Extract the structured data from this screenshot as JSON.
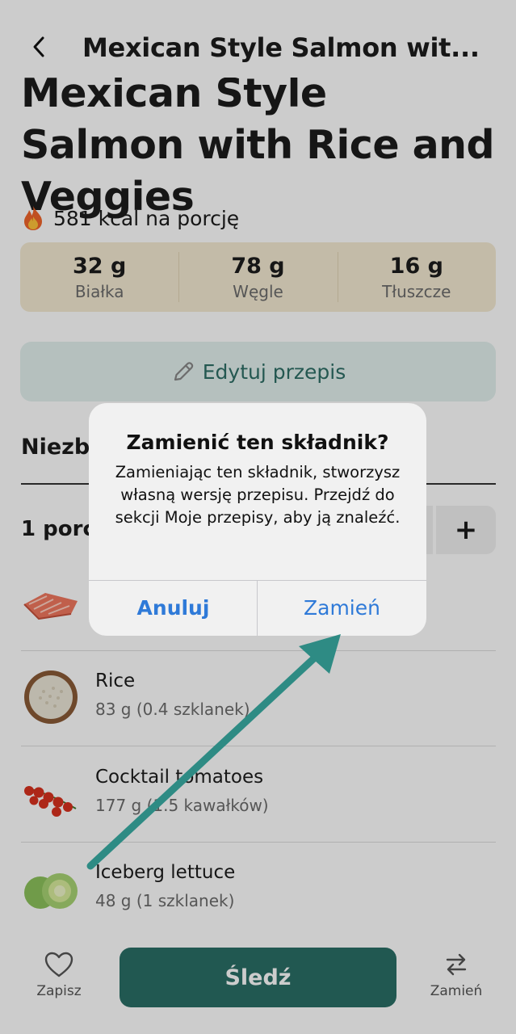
{
  "nav": {
    "title": "Mexican Style Salmon wit..."
  },
  "recipe": {
    "title": "Mexican Style Salmon with Rice and Veggies",
    "kcal_text": "581 kcal na porcję"
  },
  "macros": [
    {
      "value": "32 g",
      "label": "Białka"
    },
    {
      "value": "78 g",
      "label": "Węgle"
    },
    {
      "value": "16 g",
      "label": "Tłuszcze"
    }
  ],
  "edit_button": {
    "label": "Edytuj przepis"
  },
  "ingredients_section": {
    "title": "Niezbędne",
    "portions_label": "1 porcja",
    "stepper_plus": "+"
  },
  "ingredients": [
    {
      "name": "",
      "qty": "",
      "icon": "salmon-icon"
    },
    {
      "name": "Rice",
      "qty": "83 g (0.4 szklanek)",
      "icon": "rice-bowl-icon"
    },
    {
      "name": "Cocktail tomatoes",
      "qty": "177 g (1.5 kawałków)",
      "icon": "cherry-tomatoes-icon"
    },
    {
      "name": "Iceberg lettuce",
      "qty": "48 g (1 szklanek)",
      "icon": "lettuce-icon"
    }
  ],
  "bottom_bar": {
    "save_label": "Zapisz",
    "track_label": "Śledź",
    "swap_label": "Zamień"
  },
  "dialog": {
    "title": "Zamienić ten składnik?",
    "message": "Zamieniając ten składnik, stworzysz własną wersję przepisu. Przejdź do sekcji Moje przepisy, aby ją znaleźć.",
    "cancel_label": "Anuluj",
    "confirm_label": "Zamień"
  },
  "colors": {
    "accent": "#2a6f66",
    "macro_bg": "#f4ead3",
    "edit_bg": "#e3f0ee",
    "dialog_button": "#2f7ad8",
    "annotation_arrow": "#2e8b84"
  }
}
